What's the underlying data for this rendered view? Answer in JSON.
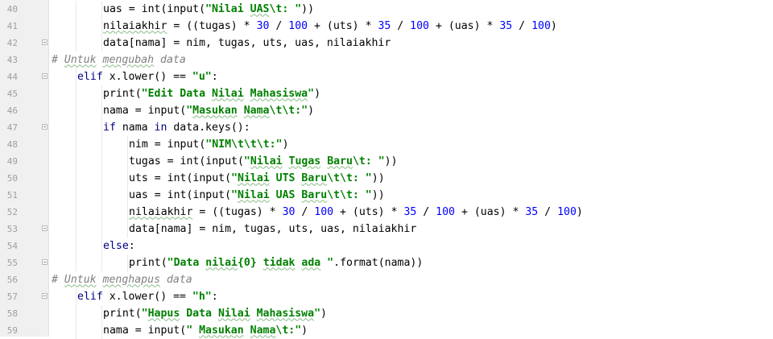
{
  "editor": {
    "lines": [
      {
        "num": "40",
        "indent": 2,
        "fold": false,
        "tokens": [
          {
            "t": "uas = int(input("
          },
          {
            "t": "\"Nilai ",
            "c": "str"
          },
          {
            "t": "UAS",
            "c": "str",
            "spell": true
          },
          {
            "t": "\\t: \"",
            "c": "str"
          },
          {
            "t": "))"
          }
        ]
      },
      {
        "num": "41",
        "indent": 2,
        "fold": false,
        "tokens": [
          {
            "t": "nilaiakhir",
            "spell": true
          },
          {
            "t": " = ((tugas) * "
          },
          {
            "t": "30",
            "c": "num"
          },
          {
            "t": " / "
          },
          {
            "t": "100",
            "c": "num"
          },
          {
            "t": " + (uts) * "
          },
          {
            "t": "35",
            "c": "num"
          },
          {
            "t": " / "
          },
          {
            "t": "100",
            "c": "num"
          },
          {
            "t": " + (uas) * "
          },
          {
            "t": "35",
            "c": "num"
          },
          {
            "t": " / "
          },
          {
            "t": "100",
            "c": "num"
          },
          {
            "t": ")"
          }
        ]
      },
      {
        "num": "42",
        "indent": 2,
        "fold": true,
        "tokens": [
          {
            "t": "data[nama] = nim, tugas, uts, uas, nilaiakhir"
          }
        ]
      },
      {
        "num": "43",
        "indent": 0,
        "fold": false,
        "tokens": [
          {
            "t": "# ",
            "c": "cm"
          },
          {
            "t": "Untuk",
            "c": "cm",
            "spell": true
          },
          {
            "t": " ",
            "c": "cm"
          },
          {
            "t": "mengubah",
            "c": "cm",
            "spell": true
          },
          {
            "t": " data",
            "c": "cm"
          }
        ]
      },
      {
        "num": "44",
        "indent": 1,
        "fold": true,
        "tokens": [
          {
            "t": "elif",
            "c": "kw"
          },
          {
            "t": " x.lower() == "
          },
          {
            "t": "\"u\"",
            "c": "str"
          },
          {
            "t": ":"
          }
        ]
      },
      {
        "num": "45",
        "indent": 2,
        "fold": false,
        "tokens": [
          {
            "t": "print("
          },
          {
            "t": "\"Edit Data ",
            "c": "str"
          },
          {
            "t": "Nilai",
            "c": "str",
            "spell": true
          },
          {
            "t": " ",
            "c": "str"
          },
          {
            "t": "Mahasiswa",
            "c": "str",
            "spell": true
          },
          {
            "t": "\"",
            "c": "str"
          },
          {
            "t": ")"
          }
        ]
      },
      {
        "num": "46",
        "indent": 2,
        "fold": false,
        "tokens": [
          {
            "t": "nama = input("
          },
          {
            "t": "\"",
            "c": "str"
          },
          {
            "t": "Masukan",
            "c": "str",
            "spell": true
          },
          {
            "t": " ",
            "c": "str"
          },
          {
            "t": "Nama",
            "c": "str",
            "spell": true
          },
          {
            "t": "\\t\\t:\"",
            "c": "str"
          },
          {
            "t": ")"
          }
        ]
      },
      {
        "num": "47",
        "indent": 2,
        "fold": true,
        "tokens": [
          {
            "t": "if",
            "c": "kw"
          },
          {
            "t": " nama "
          },
          {
            "t": "in",
            "c": "kw"
          },
          {
            "t": " data.keys():"
          }
        ]
      },
      {
        "num": "48",
        "indent": 3,
        "fold": false,
        "tokens": [
          {
            "t": "nim = input("
          },
          {
            "t": "\"NIM\\t\\t\\t:\"",
            "c": "str"
          },
          {
            "t": ")"
          }
        ]
      },
      {
        "num": "49",
        "indent": 3,
        "fold": false,
        "tokens": [
          {
            "t": "tugas = int(input("
          },
          {
            "t": "\"",
            "c": "str"
          },
          {
            "t": "Nilai",
            "c": "str",
            "spell": true
          },
          {
            "t": " ",
            "c": "str"
          },
          {
            "t": "Tugas",
            "c": "str",
            "spell": true
          },
          {
            "t": " ",
            "c": "str"
          },
          {
            "t": "Baru",
            "c": "str",
            "spell": true
          },
          {
            "t": "\\t: \"",
            "c": "str"
          },
          {
            "t": "))"
          }
        ]
      },
      {
        "num": "50",
        "indent": 3,
        "fold": false,
        "tokens": [
          {
            "t": "uts = int(input("
          },
          {
            "t": "\"",
            "c": "str"
          },
          {
            "t": "Nilai",
            "c": "str",
            "spell": true
          },
          {
            "t": " UTS ",
            "c": "str"
          },
          {
            "t": "Baru",
            "c": "str",
            "spell": true
          },
          {
            "t": "\\t\\t: \"",
            "c": "str"
          },
          {
            "t": "))"
          }
        ]
      },
      {
        "num": "51",
        "indent": 3,
        "fold": false,
        "tokens": [
          {
            "t": "uas = int(input("
          },
          {
            "t": "\"",
            "c": "str"
          },
          {
            "t": "Nilai",
            "c": "str",
            "spell": true
          },
          {
            "t": " UAS ",
            "c": "str"
          },
          {
            "t": "Baru",
            "c": "str",
            "spell": true
          },
          {
            "t": "\\t\\t: \"",
            "c": "str"
          },
          {
            "t": "))"
          }
        ]
      },
      {
        "num": "52",
        "indent": 3,
        "fold": false,
        "tokens": [
          {
            "t": "nilaiakhir",
            "spell": true
          },
          {
            "t": " = ((tugas) * "
          },
          {
            "t": "30",
            "c": "num"
          },
          {
            "t": " / "
          },
          {
            "t": "100",
            "c": "num"
          },
          {
            "t": " + (uts) * "
          },
          {
            "t": "35",
            "c": "num"
          },
          {
            "t": " / "
          },
          {
            "t": "100",
            "c": "num"
          },
          {
            "t": " + (uas) * "
          },
          {
            "t": "35",
            "c": "num"
          },
          {
            "t": " / "
          },
          {
            "t": "100",
            "c": "num"
          },
          {
            "t": ")"
          }
        ]
      },
      {
        "num": "53",
        "indent": 3,
        "fold": true,
        "tokens": [
          {
            "t": "data[nama] = nim, tugas, uts, uas, nilaiakhir"
          }
        ]
      },
      {
        "num": "54",
        "indent": 2,
        "fold": false,
        "tokens": [
          {
            "t": "else",
            "c": "kw"
          },
          {
            "t": ":"
          }
        ]
      },
      {
        "num": "55",
        "indent": 3,
        "fold": true,
        "tokens": [
          {
            "t": "print("
          },
          {
            "t": "\"Data ",
            "c": "str"
          },
          {
            "t": "nilai",
            "c": "str",
            "spell": true
          },
          {
            "t": "{0} ",
            "c": "str"
          },
          {
            "t": "tidak",
            "c": "str",
            "spell": true
          },
          {
            "t": " ",
            "c": "str"
          },
          {
            "t": "ada",
            "c": "str",
            "spell": true
          },
          {
            "t": " \"",
            "c": "str"
          },
          {
            "t": ".format(nama))"
          }
        ]
      },
      {
        "num": "56",
        "indent": 0,
        "fold": false,
        "tokens": [
          {
            "t": "# ",
            "c": "cm"
          },
          {
            "t": "Untuk",
            "c": "cm",
            "spell": true
          },
          {
            "t": " ",
            "c": "cm"
          },
          {
            "t": "menghapus",
            "c": "cm",
            "spell": true
          },
          {
            "t": " data",
            "c": "cm"
          }
        ]
      },
      {
        "num": "57",
        "indent": 1,
        "fold": true,
        "tokens": [
          {
            "t": "elif",
            "c": "kw"
          },
          {
            "t": " x.lower() == "
          },
          {
            "t": "\"h\"",
            "c": "str"
          },
          {
            "t": ":"
          }
        ]
      },
      {
        "num": "58",
        "indent": 2,
        "fold": false,
        "tokens": [
          {
            "t": "print("
          },
          {
            "t": "\"",
            "c": "str"
          },
          {
            "t": "Hapus",
            "c": "str",
            "spell": true
          },
          {
            "t": " Data ",
            "c": "str"
          },
          {
            "t": "Nilai",
            "c": "str",
            "spell": true
          },
          {
            "t": " ",
            "c": "str"
          },
          {
            "t": "Mahasiswa",
            "c": "str",
            "spell": true
          },
          {
            "t": "\"",
            "c": "str"
          },
          {
            "t": ")"
          }
        ]
      },
      {
        "num": "59",
        "indent": 2,
        "fold": false,
        "tokens": [
          {
            "t": "nama = input("
          },
          {
            "t": "\" ",
            "c": "str"
          },
          {
            "t": "Masukan",
            "c": "str",
            "spell": true
          },
          {
            "t": " ",
            "c": "str"
          },
          {
            "t": "Nama",
            "c": "str",
            "spell": true
          },
          {
            "t": "\\t:\"",
            "c": "str"
          },
          {
            "t": ")"
          }
        ]
      }
    ]
  },
  "colors": {
    "keyword": "#000080",
    "string": "#008000",
    "number": "#0000ff",
    "comment": "#808080",
    "gutter_bg": "#f0f0f0",
    "line_number": "#9e9e9e"
  }
}
